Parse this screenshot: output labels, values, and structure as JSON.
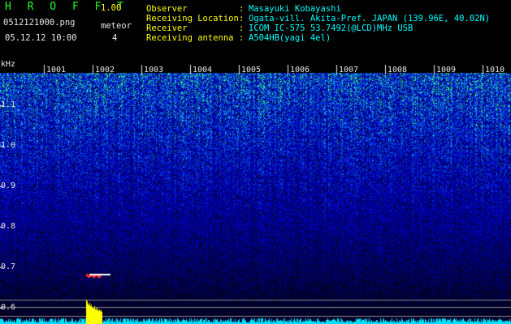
{
  "header": {
    "app_title": "H R O F F T",
    "app_version": "1.00",
    "file_name": "0512121000.png",
    "meteor_label": "meteor",
    "meteor_count": "4",
    "datetime": "05.12.12 10:00",
    "info": [
      {
        "label": "Observer",
        "value": "Masayuki Kobayashi"
      },
      {
        "label": "Receiving Location",
        "value": "Ogata-vill. Akita-Pref. JAPAN (139.96E, 40.02N)"
      },
      {
        "label": "Receiver",
        "value": "ICOM IC-575 53.7492(@LCD)MHz USB"
      },
      {
        "label": "Receiving antenna",
        "value": "A504HB(yagi 4el)"
      }
    ]
  },
  "axis": {
    "y_unit": "kHz",
    "y_ticks": [
      "1.1",
      "1.0",
      "0.9",
      "0.8",
      "0.7",
      "0.6"
    ],
    "x_ticks": [
      "1001",
      "1002",
      "1003",
      "1004",
      "1005",
      "1006",
      "1007",
      "1008",
      "1009",
      "1010"
    ]
  },
  "colors": {
    "background": "#000000",
    "label": "#ffff00",
    "value": "#00ffff",
    "title": "#22ff22",
    "spectrum_low": "#00007a",
    "spectrum_high": "#40ff80",
    "level_trace": "#00e0ff",
    "echo_trace": "#ffff00"
  }
}
